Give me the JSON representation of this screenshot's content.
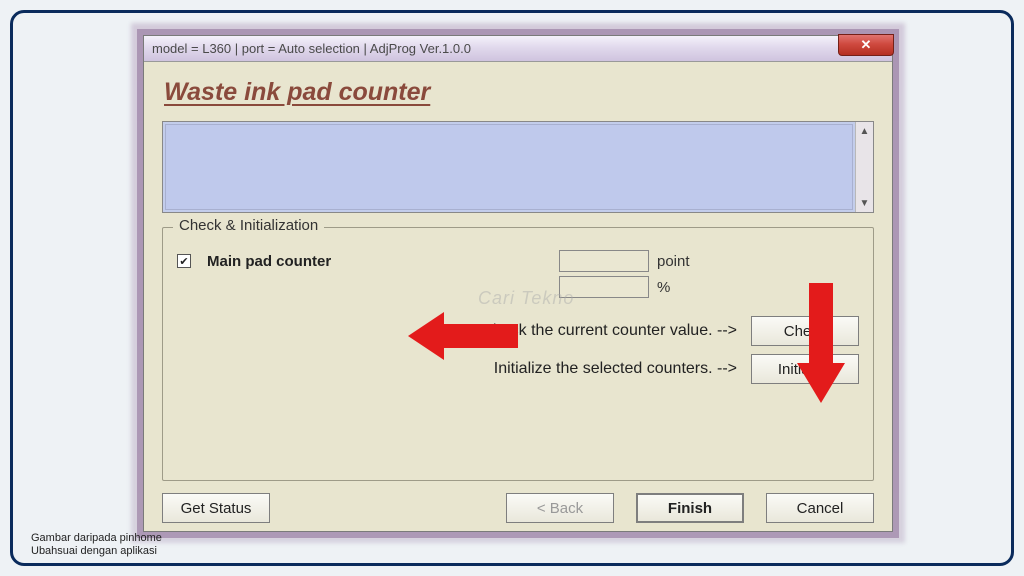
{
  "titlebar": "model = L360 | port = Auto selection | AdjProg Ver.1.0.0",
  "close_glyph": "✕",
  "heading": "Waste ink pad counter",
  "fieldset": {
    "legend": "Check & Initialization",
    "checkbox_checked": "✔",
    "main_pad_label": "Main pad counter",
    "point_value": "",
    "point_unit": "point",
    "percent_value": "",
    "percent_unit": "%",
    "check_text": "Check the current counter value. -->",
    "check_btn": "Check",
    "init_text": "Initialize the selected counters. -->",
    "init_btn": "Initialize"
  },
  "buttons": {
    "get_status": "Get Status",
    "back": "< Back",
    "finish": "Finish",
    "cancel": "Cancel"
  },
  "watermark": "Cari Tekno",
  "credit_line1": "Gambar daripada pinhome",
  "credit_line2": "Ubahsuai dengan aplikasi"
}
